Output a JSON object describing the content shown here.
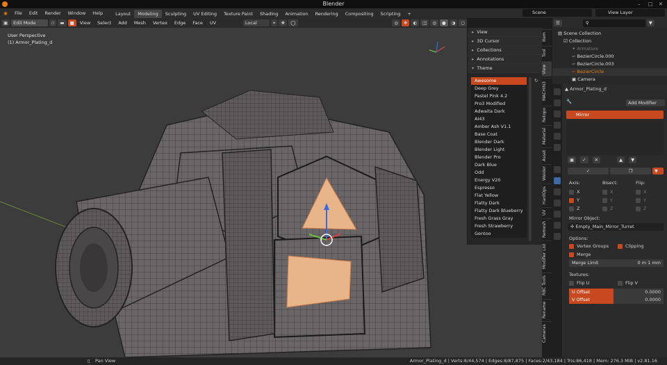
{
  "window": {
    "title": "Blender"
  },
  "menu": [
    "File",
    "Edit",
    "Render",
    "Window",
    "Help"
  ],
  "workspaces": [
    {
      "label": "Layout"
    },
    {
      "label": "Modeling",
      "active": true
    },
    {
      "label": "Sculpting"
    },
    {
      "label": "UV Editing"
    },
    {
      "label": "Texture Paint"
    },
    {
      "label": "Shading"
    },
    {
      "label": "Animation"
    },
    {
      "label": "Rendering"
    },
    {
      "label": "Compositing"
    },
    {
      "label": "Scripting"
    },
    {
      "label": "+"
    }
  ],
  "scene": {
    "label": "Scene"
  },
  "view_layer": {
    "label": "View Layer"
  },
  "header": {
    "mode": "Edit Mode",
    "menus": [
      "View",
      "Select",
      "Add",
      "Mesh",
      "Vertex",
      "Edge",
      "Face",
      "UV"
    ],
    "orientation": "Local"
  },
  "viewport": {
    "perspective": "User Perspective",
    "object": "(1) Armor_Plating_d"
  },
  "sidebar": {
    "panels": [
      "View",
      "3D Cursor",
      "Collections",
      "Annotations",
      "Theme"
    ],
    "themes": [
      "Awesome",
      "Deep Grey",
      "Pastel Pink 4.2",
      "Pro3 Modified",
      "Adwaita Dark",
      "AI43",
      "Amber Ash V1.1",
      "Base Coat",
      "Blender Dark",
      "Blender Light",
      "Blender Pro",
      "Dark Blue",
      "Odd",
      "Energy V20",
      "Espresso",
      "Flat Yellow",
      "Flatty Dark",
      "Flatty Dark Blueberry",
      "Fresh Grass Gray",
      "Fresh Strawberry",
      "Gentoo"
    ],
    "selected_theme": "Awesome"
  },
  "side_tabs": [
    "Item",
    "Tool",
    "View",
    "MACHIN3",
    "Retopo",
    "Material",
    "Asset",
    "Weider",
    "HardOps",
    "UV",
    "Remesh",
    "Modifier List",
    "RBC Tools",
    "Rename",
    "Cameras"
  ],
  "outliner": {
    "rows": [
      {
        "label": "Scene Collection",
        "indent": 0
      },
      {
        "label": "Collection",
        "indent": 1
      },
      {
        "label": "Armature",
        "indent": 2,
        "dim": true
      },
      {
        "label": "BezierCircle.000",
        "indent": 2
      },
      {
        "label": "BezierCircle.003",
        "indent": 2
      },
      {
        "label": "BezierCircle",
        "indent": 2,
        "active": true
      },
      {
        "label": "Camera",
        "indent": 2
      }
    ]
  },
  "properties": {
    "object_name": "Armor_Plating_d",
    "add_modifier": "Add Modifier",
    "modifier_name": "Mirror",
    "axis_label": "Axis:",
    "bisect_label": "Bisect:",
    "flip_label": "Flip:",
    "axes": [
      "X",
      "Y",
      "Z"
    ],
    "mirror_object_label": "Mirror Object:",
    "mirror_object": "Empty_Main_Mirror_Turret",
    "options_label": "Options:",
    "vertex_groups": "Vertex Groups",
    "clipping": "Clipping",
    "merge": "Merge",
    "merge_limit_label": "Merge Limit",
    "merge_limit_value": "0 m 1 mm",
    "textures_label": "Textures:",
    "flip_u": "Flip U",
    "flip_v": "Flip V",
    "u_offset_label": "U Offset",
    "u_offset_value": "0.0000",
    "v_offset_label": "V Offset",
    "v_offset_value": "0.0000"
  },
  "status": {
    "left": "Pan View",
    "right": "Armor_Plating_d | Verts:8/44,574 | Edges:8/87,875 | Faces:2/43,184 | Tris:86,418 | Mem: 276.3 MiB | v2.81.16"
  },
  "colors": {
    "accent": "#c8491f",
    "brand": "#e87d0d",
    "face_select": "#e8b48a"
  }
}
